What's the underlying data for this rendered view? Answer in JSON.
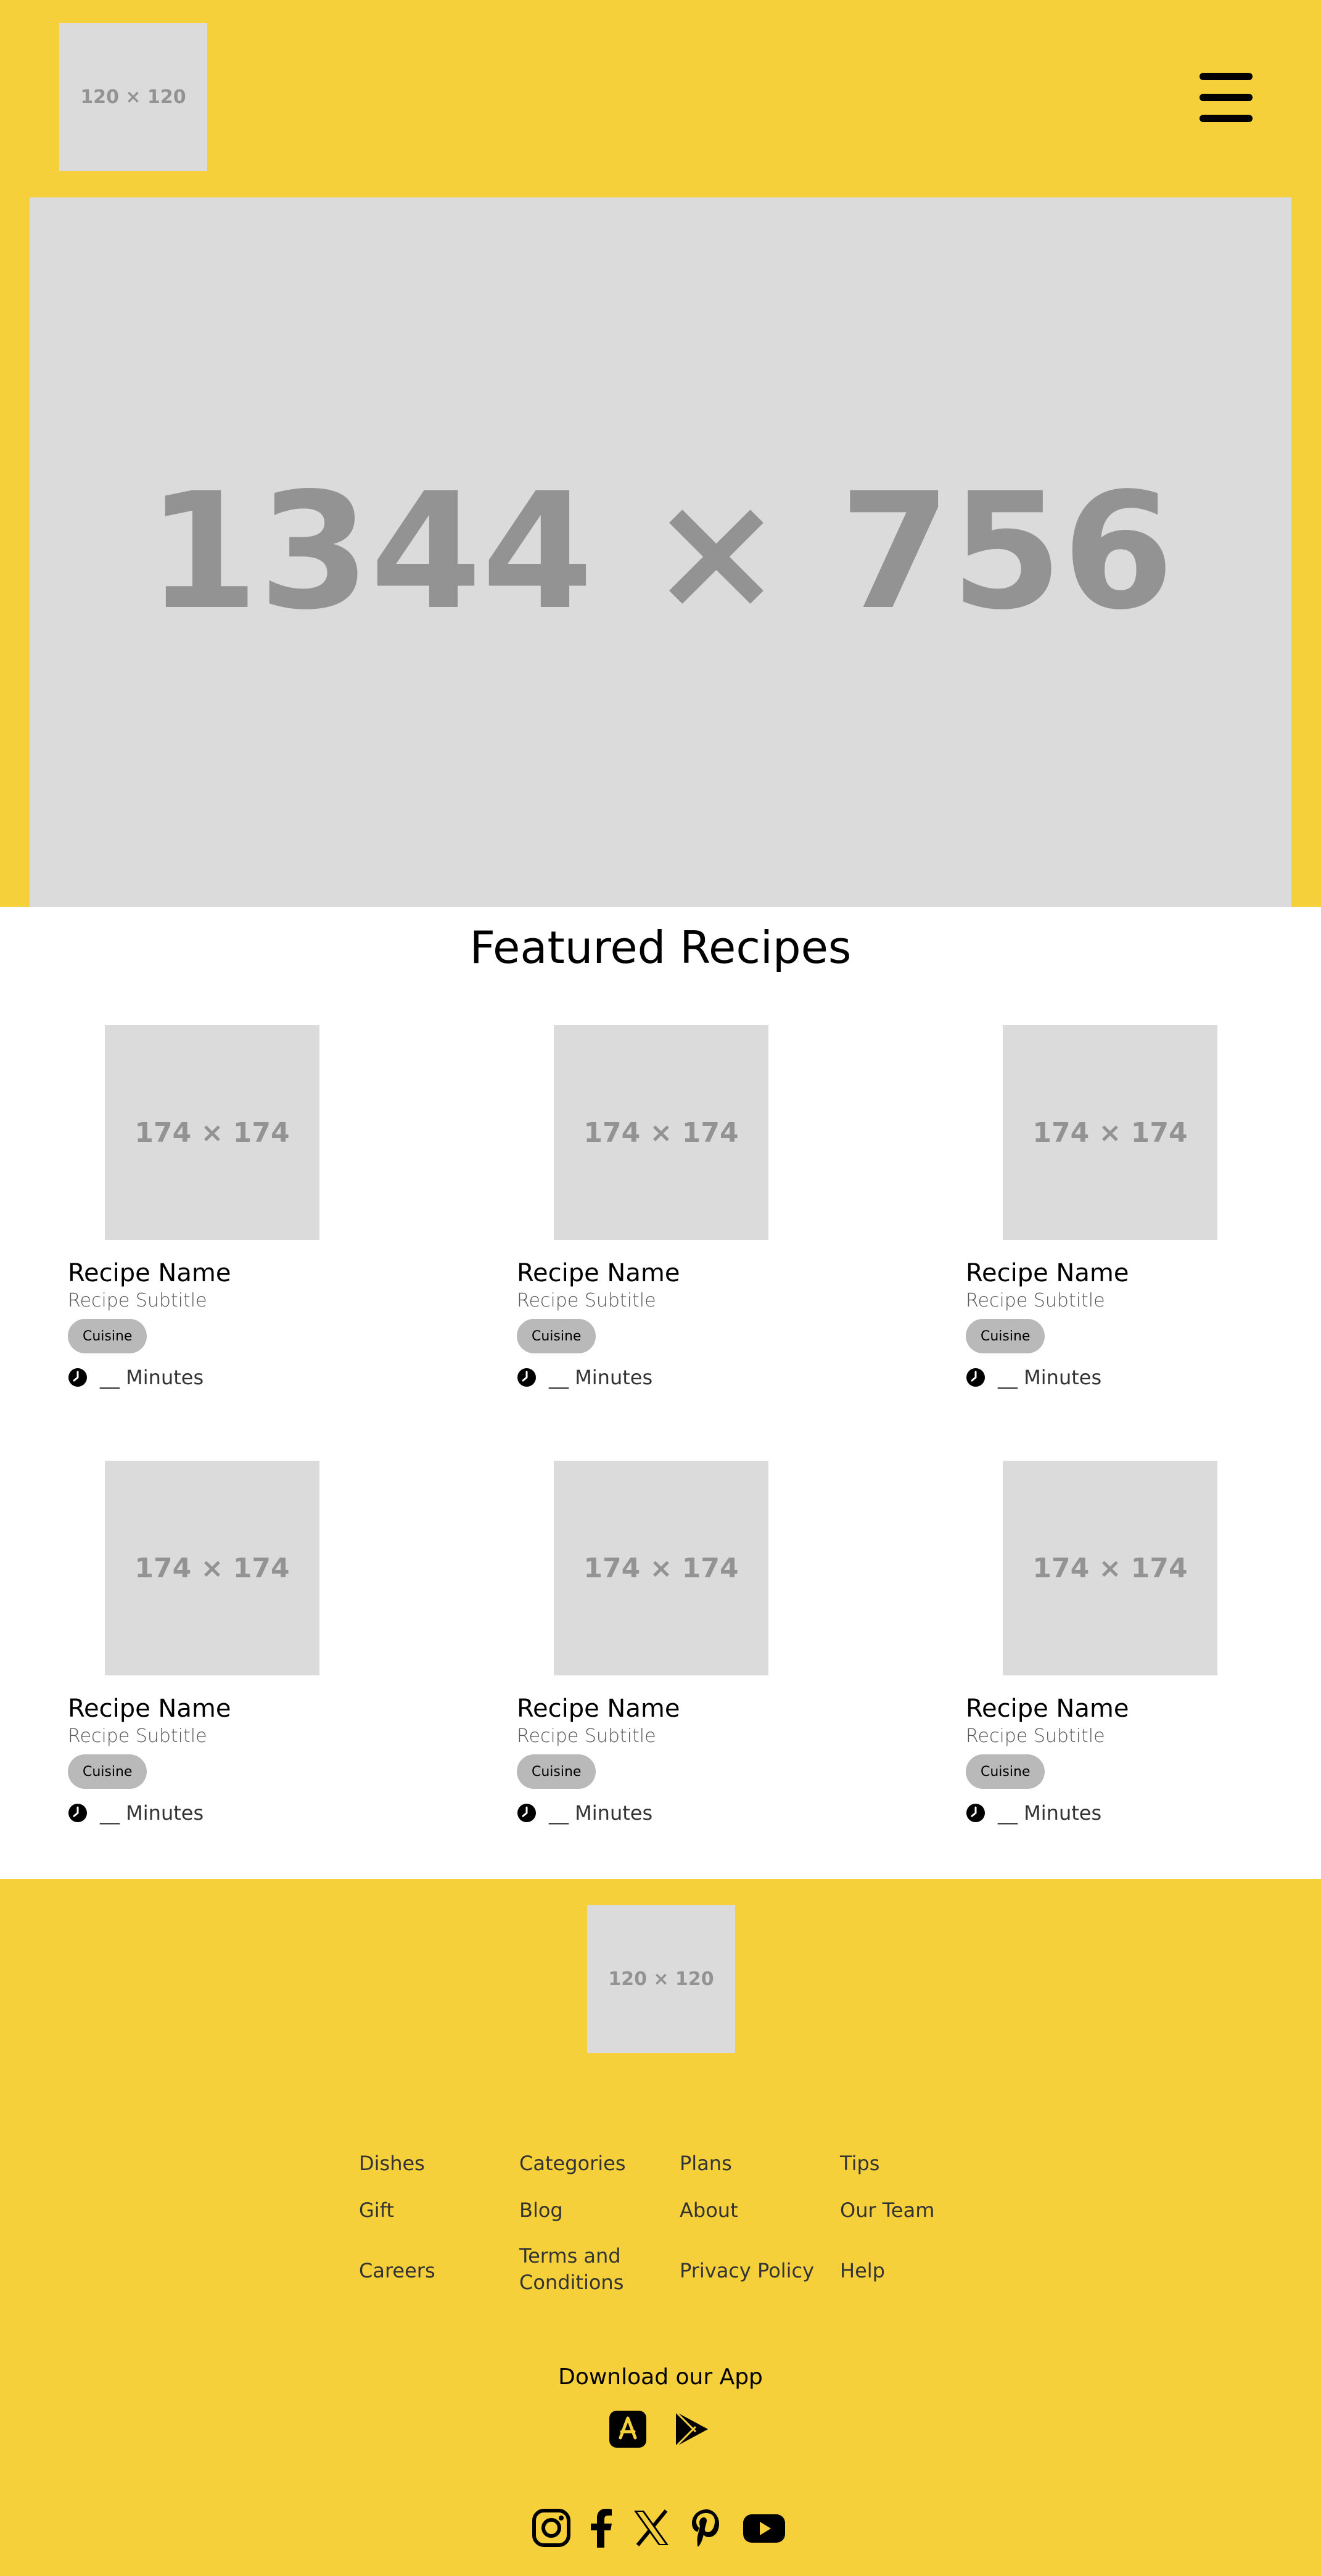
{
  "header": {
    "logo": "120 × 120",
    "menu_icon": "hamburger-menu-icon",
    "hero": "1344 × 756"
  },
  "featured": {
    "title": "Featured Recipes",
    "recipes": [
      {
        "image": "174 × 174",
        "name": "Recipe Name",
        "subtitle": "Recipe Subtitle",
        "cuisine": "Cuisine",
        "time": "__ Minutes"
      },
      {
        "image": "174 × 174",
        "name": "Recipe Name",
        "subtitle": "Recipe Subtitle",
        "cuisine": "Cuisine",
        "time": "__ Minutes"
      },
      {
        "image": "174 × 174",
        "name": "Recipe Name",
        "subtitle": "Recipe Subtitle",
        "cuisine": "Cuisine",
        "time": "__ Minutes"
      },
      {
        "image": "174 × 174",
        "name": "Recipe Name",
        "subtitle": "Recipe Subtitle",
        "cuisine": "Cuisine",
        "time": "__ Minutes"
      },
      {
        "image": "174 × 174",
        "name": "Recipe Name",
        "subtitle": "Recipe Subtitle",
        "cuisine": "Cuisine",
        "time": "__ Minutes"
      },
      {
        "image": "174 × 174",
        "name": "Recipe Name",
        "subtitle": "Recipe Subtitle",
        "cuisine": "Cuisine",
        "time": "__ Minutes"
      }
    ]
  },
  "footer": {
    "logo": "120 × 120",
    "links": [
      "Dishes",
      "Categories",
      "Plans",
      "Tips",
      "Gift",
      "Blog",
      "About",
      "Our Team",
      "Careers",
      "Terms and Conditions",
      "Privacy Policy",
      "Help"
    ],
    "app_title": "Download our App",
    "app_icons": [
      "app-store-icon",
      "google-play-icon"
    ],
    "social_icons": [
      "instagram-icon",
      "facebook-icon",
      "x-icon",
      "pinterest-icon",
      "youtube-icon"
    ]
  },
  "colors": {
    "brand_yellow": "#f5d03a",
    "placeholder": "#dbdbdb",
    "badge": "#b9b9b9"
  }
}
